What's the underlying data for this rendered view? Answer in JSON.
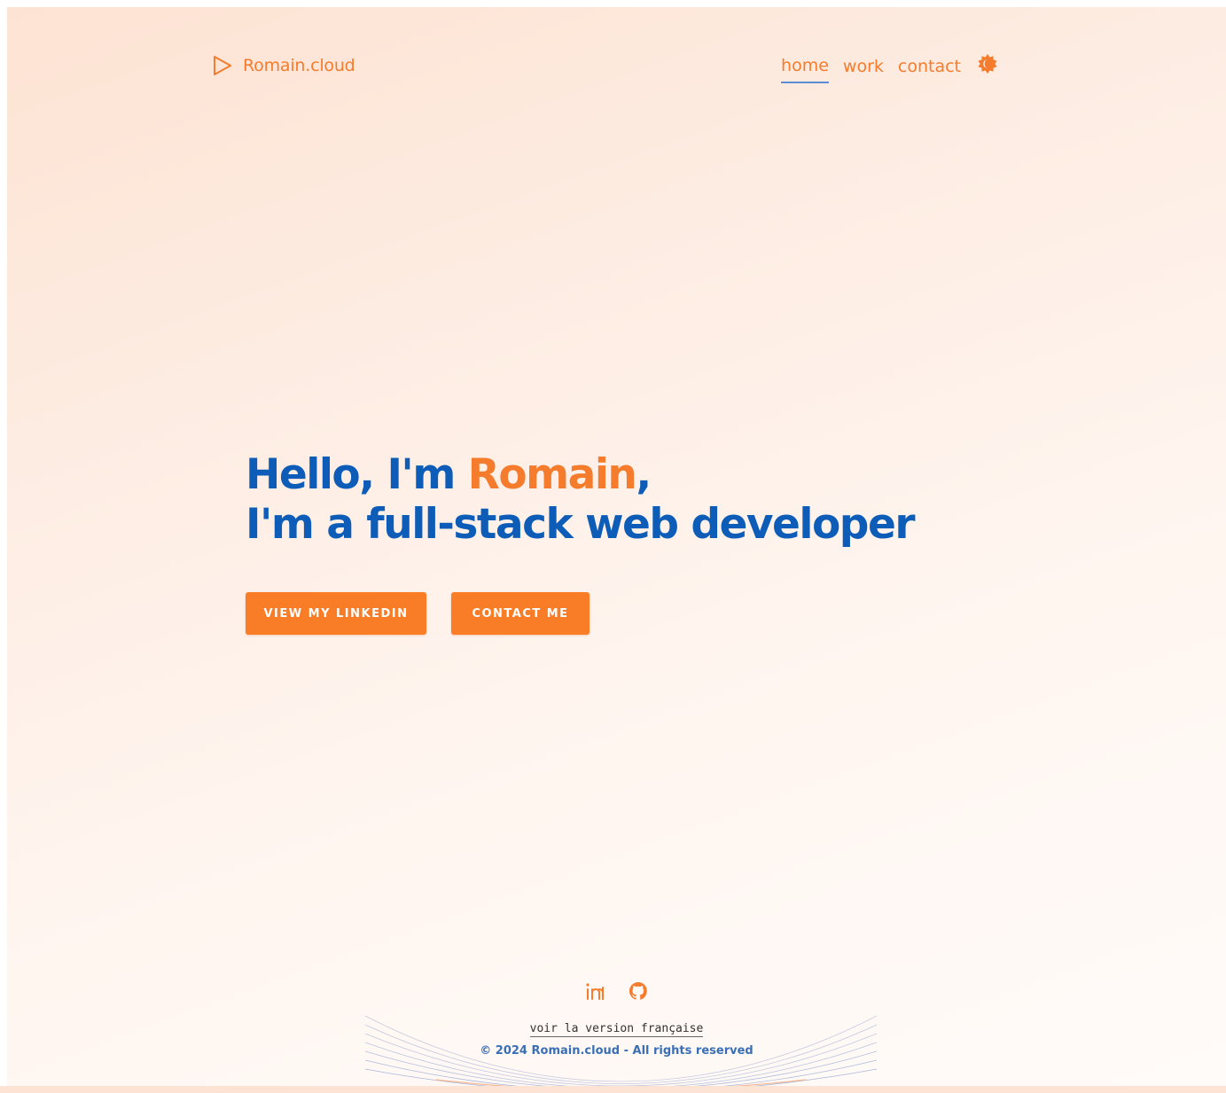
{
  "header": {
    "logo_text": "Romain.cloud",
    "logo_icon": "play-triangle-icon",
    "nav": [
      {
        "label": "home",
        "active": true
      },
      {
        "label": "work",
        "active": false
      },
      {
        "label": "contact",
        "active": false
      }
    ],
    "theme_toggle_icon": "sun-gear-icon"
  },
  "hero": {
    "line1_prefix": "Hello, I'm ",
    "line1_name": "Romain",
    "line1_suffix": ",",
    "line2": "I'm a full-stack web developer",
    "buttons": {
      "linkedin": "VIEW MY LINKEDIN",
      "contact": "CONTACT ME"
    }
  },
  "footer": {
    "socials": [
      {
        "icon": "linkedin-icon"
      },
      {
        "icon": "github-icon"
      }
    ],
    "language_link": "voir la version française",
    "copyright": "© 2024 Romain.cloud - All rights reserved"
  },
  "colors": {
    "accent": "#f47c2c",
    "primary": "#0d5db8",
    "nav_underline": "#5b8dd6",
    "copyright": "#3a6fb5"
  }
}
